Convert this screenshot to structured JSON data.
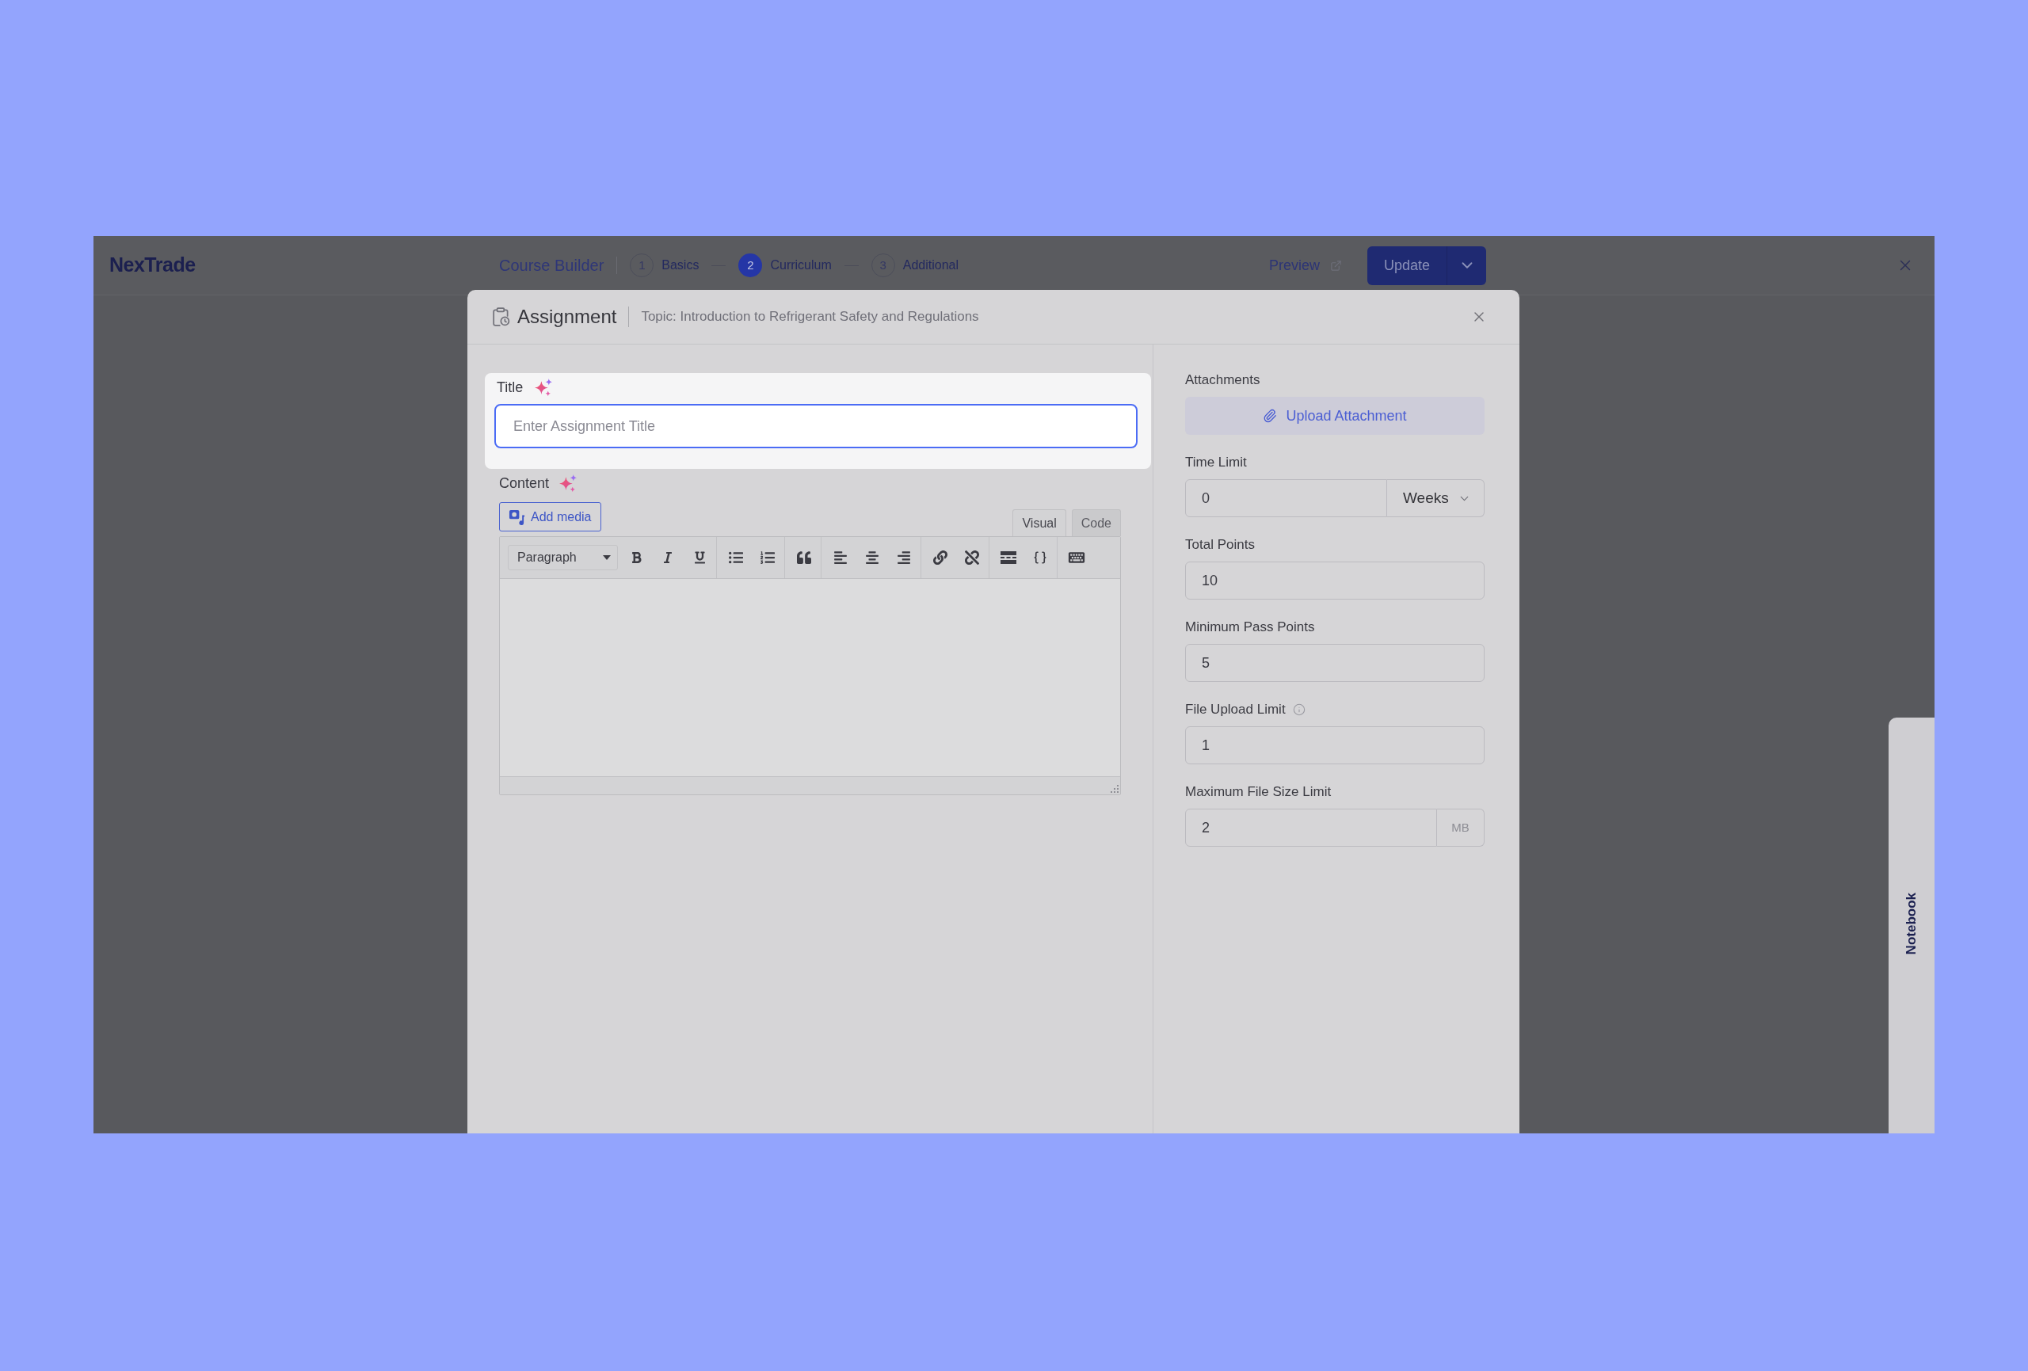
{
  "topbar": {
    "logo": "NexTrade",
    "title": "Course Builder",
    "steps": [
      {
        "number": "1",
        "label": "Basics",
        "selected": false
      },
      {
        "number": "2",
        "label": "Curriculum",
        "selected": true
      },
      {
        "number": "3",
        "label": "Additional",
        "selected": false
      }
    ],
    "preview": "Preview",
    "update": "Update"
  },
  "modal": {
    "title": "Assignment",
    "topic": "Topic: Introduction to Refrigerant Safety and Regulations",
    "title_field": {
      "label": "Title",
      "placeholder": "Enter Assignment Title",
      "highlighted": true,
      "focused": true
    },
    "content": {
      "label": "Content",
      "add_media": "Add media",
      "editor_tabs": [
        {
          "label": "Visual",
          "selected": true
        },
        {
          "label": "Code",
          "selected": false
        }
      ],
      "format": "Paragraph"
    },
    "attachments": {
      "label": "Attachments",
      "button": "Upload Attachment"
    },
    "fields": [
      {
        "kind": "select",
        "label": "Time Limit",
        "value": "0",
        "unit": "Weeks"
      },
      {
        "kind": "plain",
        "label": "Total Points",
        "value": "10"
      },
      {
        "kind": "plain",
        "label": "Minimum Pass Points",
        "value": "5"
      },
      {
        "kind": "info",
        "label": "File Upload Limit",
        "value": "1"
      },
      {
        "kind": "suffix",
        "label": "Maximum File Size Limit",
        "value": "2",
        "unit": "MB"
      }
    ]
  },
  "notebook": {
    "label": "Notebook"
  }
}
